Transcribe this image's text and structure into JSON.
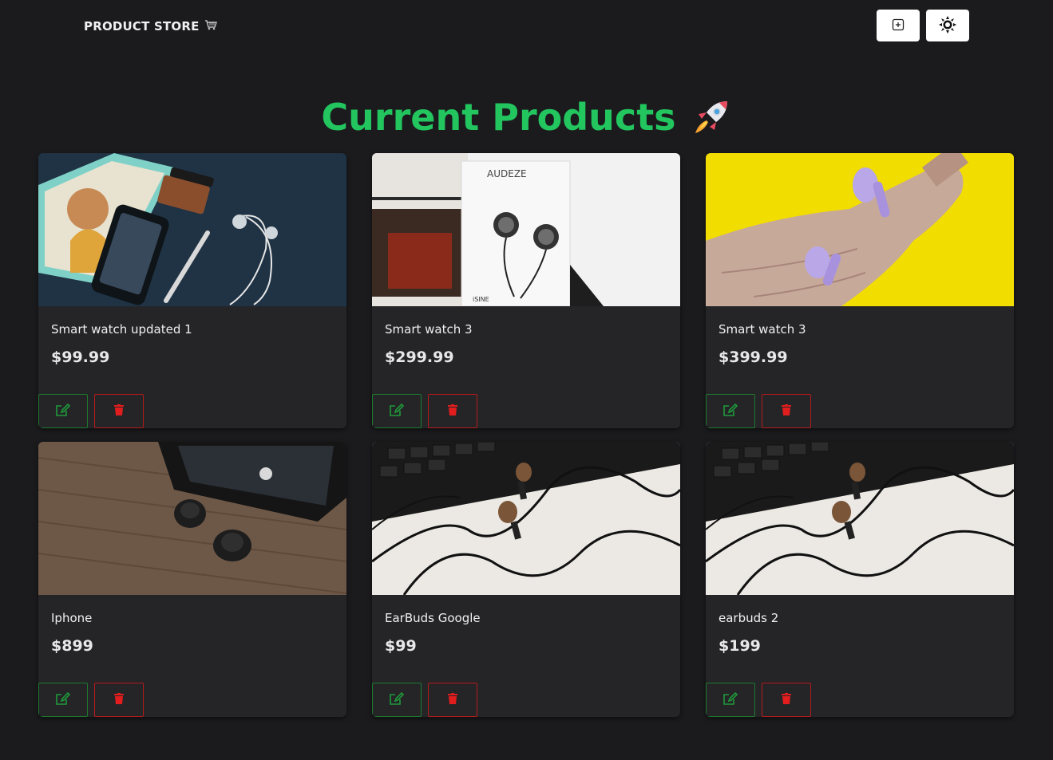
{
  "header": {
    "brand": "PRODUCT STORE",
    "brand_icon": "shopping-cart-icon",
    "add_button_icon": "plus-square-icon",
    "theme_button_icon": "sun-icon"
  },
  "main": {
    "title": "Current Products",
    "title_icon": "rocket-icon",
    "accent_color": "#22c55e"
  },
  "products": [
    {
      "name": "Smart watch updated 1",
      "price": "$99.99",
      "image": "flatlay-phone-earphones-book"
    },
    {
      "name": "Smart watch 3",
      "price": "$299.99",
      "image": "audeze-isine-earphones-box"
    },
    {
      "name": "Smart watch 3",
      "price": "$399.99",
      "image": "purple-earbuds-in-hand"
    },
    {
      "name": "Iphone",
      "price": "$899",
      "image": "earbuds-and-phone-on-wood"
    },
    {
      "name": "EarBuds Google",
      "price": "$99",
      "image": "wired-earphones-on-keyboard"
    },
    {
      "name": "earbuds 2",
      "price": "$199",
      "image": "wired-earphones-on-keyboard"
    }
  ],
  "actions": {
    "edit_icon": "edit-icon",
    "delete_icon": "trash-icon",
    "edit_color": "#1c7a2e",
    "delete_color": "#e11d1d"
  }
}
